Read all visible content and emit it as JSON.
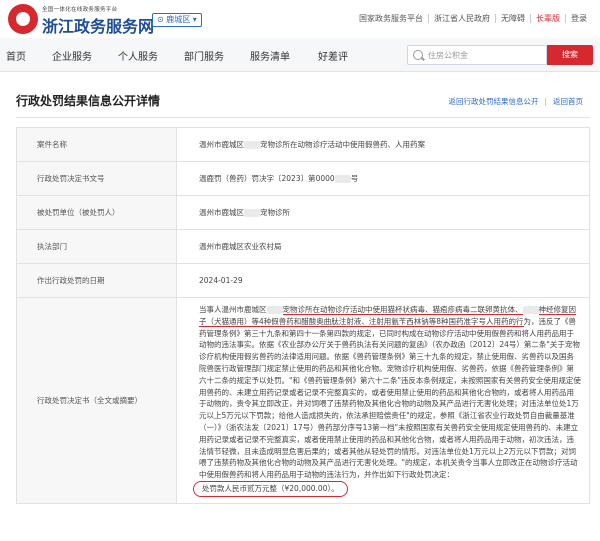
{
  "header": {
    "logo_sub": "全国一体化在线政务服务平台",
    "logo_main": "浙江政务服务网",
    "region": "鹿城区",
    "links": [
      "国家政务服务平台",
      "浙江省人民政府",
      "无障碍",
      "长辈版",
      "登录"
    ]
  },
  "nav": {
    "items": [
      "首页",
      "企业服务",
      "个人服务",
      "部门服务",
      "服务清单",
      "好差评"
    ],
    "search_placeholder": "住房公积金",
    "search_button": "搜索"
  },
  "page": {
    "title": "行政处罚结果信息公开详情",
    "return_links": [
      "返回行政处罚结果信息公开",
      "返回首页"
    ]
  },
  "details": {
    "case_name_label": "案件名称",
    "case_name_a": "温州市鹿城区",
    "case_name_b": "宠物诊所在动物诊疗活动中使用假兽药、人用药案",
    "doc_no_label": "行政处罚决定书文号",
    "doc_no_a": "温鹿罚（兽药）罚决字〔2023〕第0000",
    "doc_no_b": "号",
    "party_label": "被处罚单位（被处罚人）",
    "party_a": "温州市鹿城区",
    "party_b": "宠物诊所",
    "dept_label": "执法部门",
    "dept_value": "温州市鹿城区农业农村局",
    "date_label": "作出行政处罚的日期",
    "date_value": "2024-01-29",
    "decision_label": "行政处罚决定书（全文或摘要）",
    "decision_p1": "当事人温州市鹿城区",
    "decision_p2": "宠物诊所在动物诊疗活动中使用猫杯状病毒、猫疱疹病毒二联卵黄抗体、",
    "decision_p3": "神经修复因子（犬猫通用）等4种假兽药和醋酸奥曲肽注射液、注射用氨苄西林钠等8种国药准字号人用药的行",
    "decision_p4": "为，违反了《兽药管理条例》第三十九条和第四十一条第四款的规定，已同时构成在动物诊疗活动中使用假兽药和将人用药品用于动物的违法事实。依据《农业部办公厅关于兽药执法有关问题的复函》（农办政函〔2012〕24号）第二条\"关于宠物诊疗机构使用假劣兽药的法律适用问题。依据《兽药管理条例》第三十九条的规定，禁止使用假、劣兽药以及国务院兽医行政管理部门规定禁止使用的药品和其他化合物。宠物诊疗机构使用假、劣兽药，依据《兽药管理条例》第六十二条的规定予以处罚。\"和《兽药管理条例》第六十二条\"违反本条例规定，未按照国家有关兽药安全使用规定使用兽药的、未建立用药记录或者记录不完整真实的，或者使用禁止使用的药品和其他化合物的，或者将人用药品用于动物的，责令其立即改正，并对饲喂了违禁药物及其他化合物的动物及其产品进行无害化处理；对违法单位处1万元以上5万元以下罚款；给他人造成损失的，依法承担赔偿责任\"的规定，参照《浙江省农业行政处罚自由裁量基准（一）》（浙农法发〔2021〕17号）兽药部分序号13第一档\"未按照国家有关兽药安全使用规定使用兽药的、未建立用药记录或者记录不完整真实，或者使用禁止使用的药品和其他化合物，或者将人用药品用于动物，初次违法，违法情节轻微，且未造成明显危害后果的；或者其他从轻处罚的情形。对违法单位处1万元以上2万元以下罚款；对饲喂了违禁药物及其他化合物的动物及其产品进行无害化处理。\"的规定，本机关责令当事人立即改正在动物诊疗活动中使用假兽药和将人用药品用于动物的违法行为，并作出如下行政处罚决定：",
    "decision_fine": "处罚款人民币贰万元整（¥20,000.00）。"
  },
  "colors": {
    "brand_red": "#d7282f",
    "brand_blue": "#1f4e96",
    "link_blue": "#2d6bd2"
  }
}
